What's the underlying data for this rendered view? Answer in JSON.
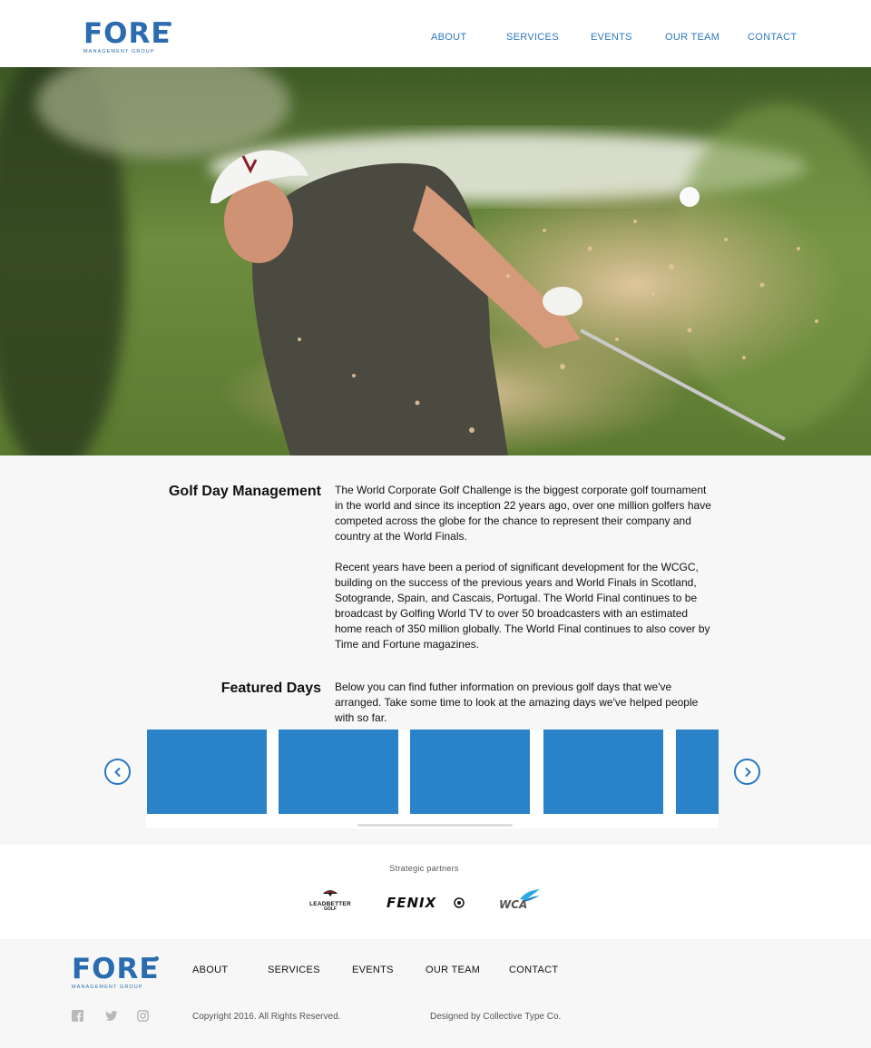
{
  "header": {
    "logo_word": "FORE",
    "logo_sub": "MANAGEMENT GROUP",
    "nav": [
      "ABOUT",
      "SERVICES",
      "EVENTS",
      "OUR TEAM",
      "CONTACT"
    ]
  },
  "hero": {
    "alt": "Golfer hitting ball out of sand bunker"
  },
  "golf_day": {
    "title": "Golf Day Management",
    "para1": "The World Corporate Golf Challenge is the biggest corporate golf tournament in the world and since its inception 22 years ago, over one million golfers have competed across the globe for the chance to represent their company and country at the World Finals.",
    "para2": "Recent years have been a period of significant development for the WCGC, building on the success of the previous years and World Finals in Scotland, Sotogrande, Spain, and Cascais, Portugal. The World Final continues to be broadcast by Golfing World TV to over 50 broadcasters with an estimated home reach of 350 million globally. The World Final continues to also cover by Time and Fortune magazines."
  },
  "featured": {
    "title": "Featured Days",
    "text": "Below you can find futher information on previous golf days that we've arranged. Take some time to look at the amazing days we've helped people with so far.",
    "card_color": "#2a82c9"
  },
  "partners": {
    "title": "Strategic partners",
    "logos": [
      "LEADBETTER GOLF",
      "FENIX",
      "WCA"
    ],
    "leadbetter": "LEADBETTER",
    "leadbetter_golf": "GOLF",
    "fenix": "FENIX",
    "wca": "WCA"
  },
  "footer": {
    "logo_word": "FORE",
    "logo_sub": "MANAGEMENT GROUP",
    "nav": [
      "ABOUT",
      "SERVICES",
      "EVENTS",
      "OUR TEAM",
      "CONTACT"
    ],
    "copyright": "Copyright 2016. All Rights Reserved.",
    "designed_by": "Designed by Collective Type Co.",
    "social_icons": [
      "facebook-icon",
      "twitter-icon",
      "instagram-icon"
    ]
  },
  "colors": {
    "brand_blue": "#2b6cb0",
    "nav_blue": "#2b78c0"
  }
}
